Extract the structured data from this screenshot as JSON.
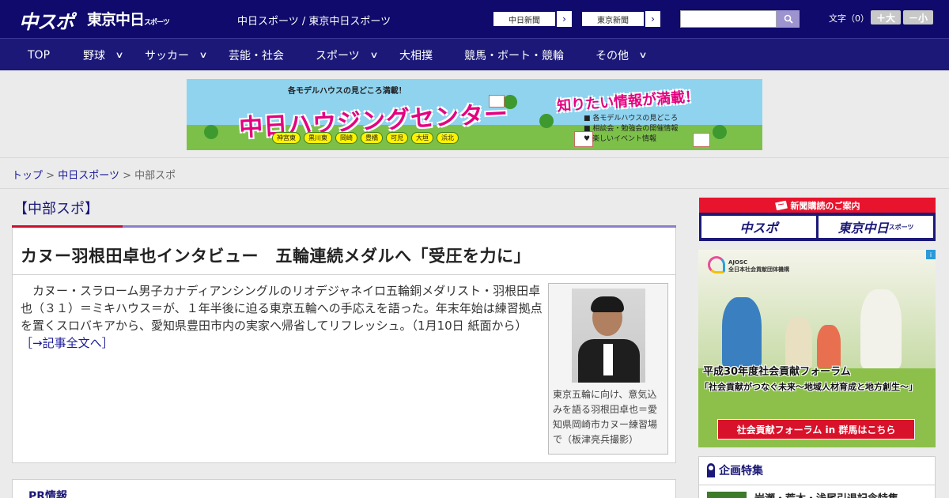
{
  "header": {
    "logo_chuspo": "中スポ",
    "logo_tokyo": "東京中日",
    "logo_tokyo_small": "スポーツ",
    "site_link": "中日スポーツ / 東京中日スポーツ",
    "paper_buttons": [
      {
        "label": "中日新聞",
        "arrow": "›"
      },
      {
        "label": "東京新聞",
        "arrow": "›"
      }
    ],
    "search": {
      "value": "",
      "placeholder": "",
      "icon": "search-icon"
    },
    "font_size_label": "文字（0）",
    "font_larger": "＋大",
    "font_smaller": "－小"
  },
  "nav": {
    "items": [
      {
        "label": "TOP",
        "has_menu": false
      },
      {
        "label": "野球",
        "has_menu": true
      },
      {
        "label": "サッカー",
        "has_menu": true
      },
      {
        "label": "芸能・社会",
        "has_menu": false
      },
      {
        "label": "スポーツ",
        "has_menu": true
      },
      {
        "label": "大相撲",
        "has_menu": false
      },
      {
        "label": "競馬・ボート・競輪",
        "has_menu": false
      },
      {
        "label": "その他",
        "has_menu": true
      }
    ],
    "chevron": "∨"
  },
  "banner_ad": {
    "top_text": "各モデルハウスの見どころ満載！",
    "headline": "中日ハウジングセンター",
    "burst": "知りたい情報が満載！",
    "info": [
      "各モデルハウスの見どころ",
      "相談会・勉強会の開催情報",
      "楽しいイベント情報"
    ],
    "cities": [
      "神宮東",
      "黒川東",
      "岡崎",
      "豊橋",
      "可児",
      "大垣",
      "浜北"
    ]
  },
  "breadcrumb": {
    "home": "トップ",
    "sep": ">",
    "parent": "中日スポーツ",
    "current": "中部スポ"
  },
  "section": {
    "title": "【中部スポ】"
  },
  "article": {
    "title": "カヌー羽根田卓也インタビュー　五輪連続メダルへ「受圧を力に」",
    "lead": "　カヌー・スラローム男子カナディアンシングルのリオデジャネイロ五輪銅メダリスト・羽根田卓也（３１）＝ミキハウス＝が、１年半後に迫る東京五輪への手応えを語った。年末年始は練習拠点を置くスロバキアから、愛知県豊田市内の実家へ帰省してリフレッシュ。（1月10日 紙面から）",
    "more_link": "［→記事全文へ］",
    "photo_caption": "東京五輪に向け、意気込みを語る羽根田卓也＝愛知県岡崎市カヌー練習場で（板津亮兵撮影）"
  },
  "pr": {
    "title": "PR情報"
  },
  "sidebar": {
    "subscribe_head": "新聞購読のご案内",
    "subscribe_logos": [
      {
        "main": "中スポ",
        "small": ""
      },
      {
        "main": "東京中日",
        "small": "スポーツ"
      }
    ],
    "ad": {
      "org_abbr": "AJOSC",
      "org_name": "全日本社会貢献団体機構",
      "line1": "平成30年度社会貢献フォーラム",
      "line2": "「社会貢献がつなぐ未来～地域人材育成と地方創生～」",
      "cta": "社会貢献フォーラム in 群馬はこちら",
      "adchoice": "i"
    },
    "feature": {
      "title": "企画特集",
      "item": "岩瀬・荒木・浅尾引退記念特集"
    }
  },
  "colors": {
    "header_bg": "#0f0a6b",
    "nav_bg": "#1b1878",
    "accent_red": "#c8102e",
    "link": "#1a1a9a"
  }
}
